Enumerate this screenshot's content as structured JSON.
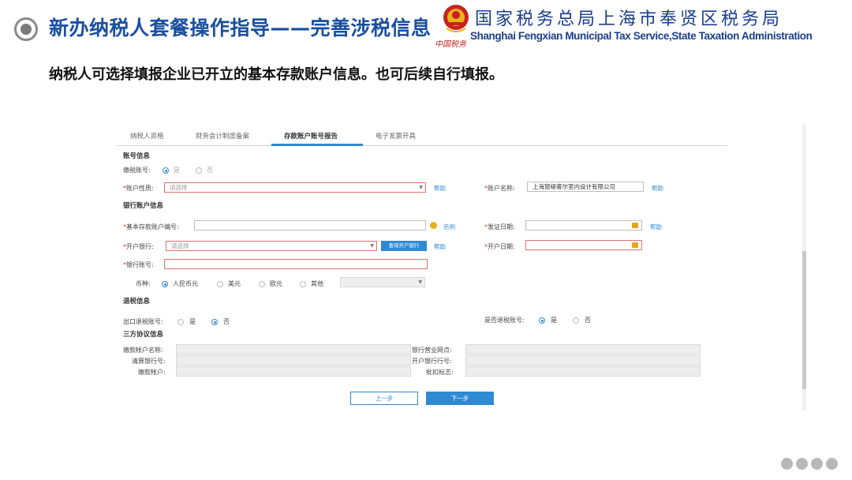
{
  "slide": {
    "title": "新办纳税人套餐操作指导——完善涉税信息",
    "org_cn": "国家税务总局上海市奉贤区税务局",
    "org_en": "Shanghai Fengxian Municipal Tax Service,State Taxation Administration",
    "seal_text": "中国税务",
    "subtitle": "纳税人可选择填报企业已开立的基本存款账户信息。也可后续自行填报。"
  },
  "tabs": [
    "纳税人资格",
    "财务会计制度备案",
    "存款账户账号报告",
    "电子发票开具"
  ],
  "active_tab": "存款账户账号报告",
  "account_info": {
    "section": "账号信息",
    "tax_account_label": "缴税账号:",
    "yes": "是",
    "no": "否",
    "nature_label": "账户性质:",
    "nature_placeholder": "请选择",
    "help": "帮助",
    "name_label": "账户名称:",
    "name_value": "上海窗缇睿尔室内设计有限公司"
  },
  "bank_info": {
    "section": "银行账户信息",
    "permit_label": "基本存款账户编号:",
    "example": "示例",
    "issue_date_label": "发证日期:",
    "help": "帮助",
    "bank_label": "开户银行:",
    "bank_placeholder": "请选择",
    "query_button": "查询开户银行",
    "open_date_label": "开户日期:",
    "account_no_label": "银行账号:",
    "currency_label": "币种:",
    "currencies": [
      "人民币元",
      "美元",
      "欧元",
      "其他"
    ],
    "selected_currency": "人民币元"
  },
  "refund_info": {
    "section": "退税信息",
    "export_refund_label": "出口退税账号:",
    "refund_label": "是否退税账号:",
    "yes": "是",
    "no": "否",
    "export_refund_selected": "否",
    "refund_selected": "是"
  },
  "agreement": {
    "section": "三方协议信息",
    "payer_name": "缴款帐户名称:",
    "bank_outlet": "银行营业网点:",
    "clearing_bank": "清算银行号:",
    "opening_bank_no": "开户银行行号:",
    "payer_account": "缴款帐户:",
    "approval": "批扣标志:"
  },
  "buttons": {
    "prev": "上一步",
    "next": "下一步"
  },
  "colors": {
    "accent": "#2f8ad3",
    "title": "#1a4fa0",
    "error": "#e07070"
  }
}
